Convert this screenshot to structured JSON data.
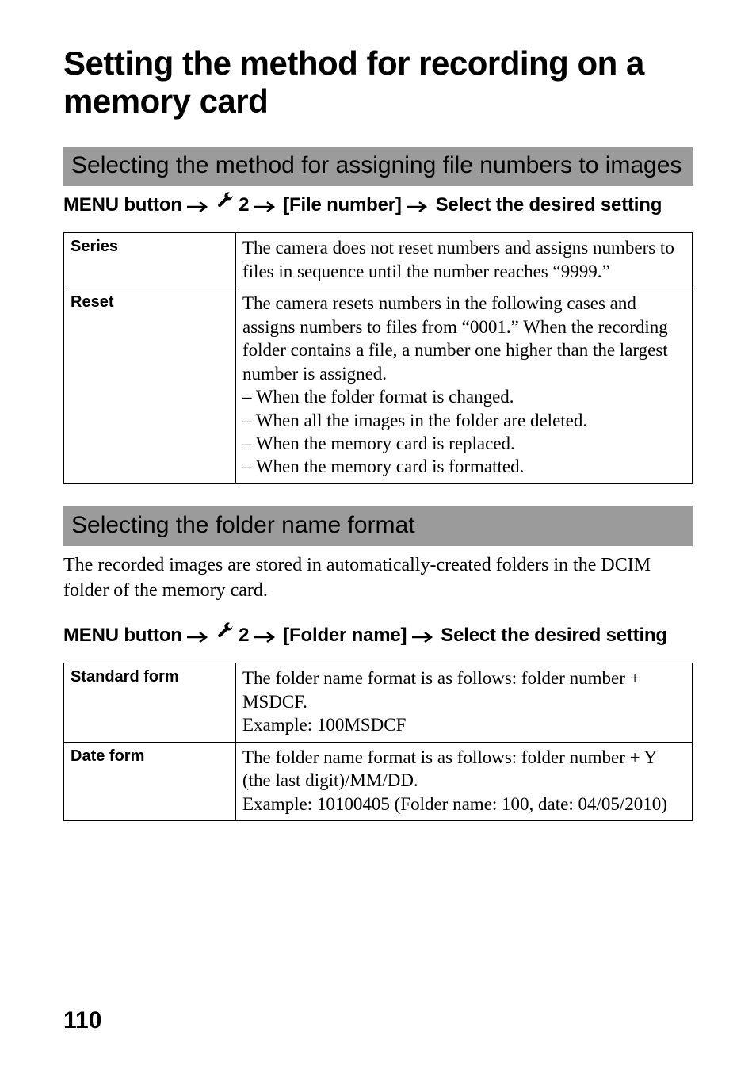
{
  "title": "Setting the method for recording on a memory card",
  "section1": {
    "heading": "Selecting the method for assigning file numbers to images",
    "menu_path": {
      "prefix": "MENU button",
      "tab_number": "2",
      "item": "[File number]",
      "suffix": "Select the desired setting"
    },
    "rows": [
      {
        "label": "Series",
        "desc": "The camera does not reset numbers and assigns numbers to files in sequence until the number reaches “9999.”"
      },
      {
        "label": "Reset",
        "desc": "The camera resets numbers in the following cases and assigns numbers to files from “0001.” When the recording folder contains a file, a number one higher than the largest number is assigned.\n– When the folder format is changed.\n– When all the images in the folder are deleted.\n– When the memory card is replaced.\n– When the memory card is formatted."
      }
    ]
  },
  "section2": {
    "heading": "Selecting the folder name format",
    "intro": "The recorded images are stored in automatically-created folders in the DCIM folder of the memory card.",
    "menu_path": {
      "prefix": "MENU button",
      "tab_number": "2",
      "item": "[Folder name]",
      "suffix": "Select the desired setting"
    },
    "rows": [
      {
        "label": "Standard form",
        "desc": "The folder name format is as follows: folder number + MSDCF.\nExample: 100MSDCF"
      },
      {
        "label": "Date form",
        "desc": "The folder name format is as follows: folder number + Y (the last digit)/MM/DD.\nExample: 10100405 (Folder name: 100, date: 04/05/2010)"
      }
    ]
  },
  "page_number": "110"
}
